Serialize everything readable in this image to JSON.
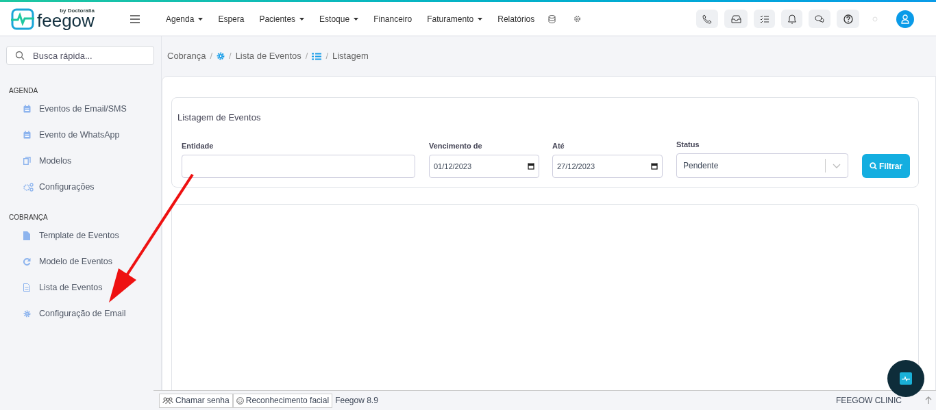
{
  "brand": {
    "name": "feegow",
    "byline": "by Doctoralia"
  },
  "nav": [
    {
      "label": "Agenda",
      "dropdown": true
    },
    {
      "label": "Espera",
      "dropdown": false
    },
    {
      "label": "Pacientes",
      "dropdown": true
    },
    {
      "label": "Estoque",
      "dropdown": true
    },
    {
      "label": "Financeiro",
      "dropdown": false
    },
    {
      "label": "Faturamento",
      "dropdown": true
    },
    {
      "label": "Relatórios",
      "dropdown": false
    }
  ],
  "search": {
    "placeholder": "Busca rápida..."
  },
  "breadcrumb": [
    {
      "kind": "link",
      "text": "Cobrança"
    },
    {
      "kind": "separator",
      "text": "/"
    },
    {
      "kind": "gear"
    },
    {
      "kind": "separator",
      "text": "/"
    },
    {
      "kind": "link",
      "text": "Lista de Eventos"
    },
    {
      "kind": "separator",
      "text": "/"
    },
    {
      "kind": "list"
    },
    {
      "kind": "separator",
      "text": "/"
    },
    {
      "kind": "link",
      "text": "Listagem"
    }
  ],
  "sidebar": [
    {
      "heading": "AGENDA",
      "items": [
        {
          "label": "Eventos de Email/SMS",
          "kind": "calendar"
        },
        {
          "label": "Evento de WhatsApp",
          "kind": "calendar"
        },
        {
          "label": "Modelos",
          "kind": "copy"
        },
        {
          "label": "Configurações",
          "kind": "gears"
        }
      ]
    },
    {
      "heading": "COBRANÇA",
      "items": [
        {
          "label": "Template de Eventos",
          "kind": "file"
        },
        {
          "label": "Modelo de Eventos",
          "kind": "refresh"
        },
        {
          "label": "Lista de Eventos",
          "kind": "doc"
        },
        {
          "label": "Configuração de Email",
          "kind": "gear"
        }
      ]
    }
  ],
  "filter": {
    "title": "Listagem de Eventos",
    "entidade_label": "Entidade",
    "vencimento_label": "Vencimento de",
    "vencimento_value": "01/12/2023",
    "ate_label": "Até",
    "ate_value": "27/12/2023",
    "status_label": "Status",
    "status_value": "Pendente",
    "button": "Filtrar"
  },
  "footer": {
    "buttons": [
      "Chamar senha",
      "Reconhecimento facial"
    ],
    "version": "Feegow 8.9",
    "clinic": "FEEGOW CLINIC"
  }
}
